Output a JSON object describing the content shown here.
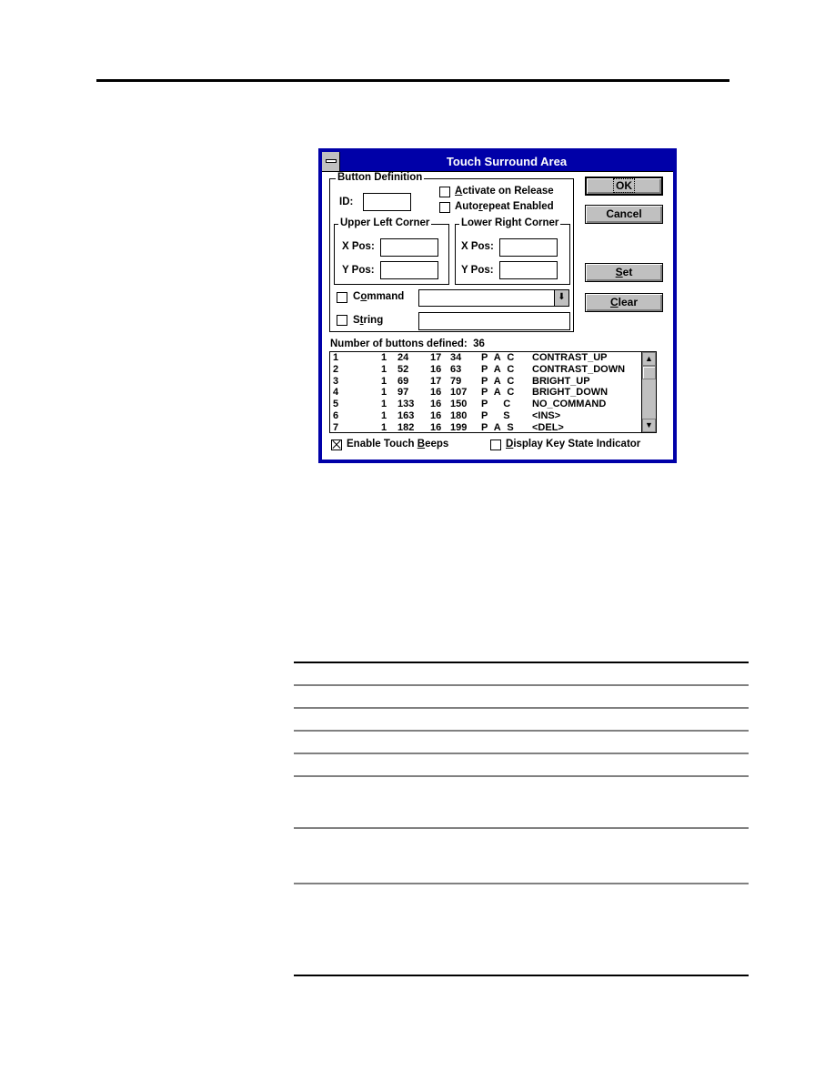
{
  "dialog": {
    "title": "Touch Surround Area",
    "button_definition": {
      "group_label": "Button Definition",
      "id_label": "ID:",
      "id_value": "",
      "activate_on_release": {
        "label_pre": "",
        "label_u": "A",
        "label_post": "ctivate on Release",
        "checked": false
      },
      "autorepeat_enabled": {
        "label_pre": "Auto",
        "label_u": "r",
        "label_post": "epeat Enabled",
        "checked": false
      },
      "upper_left": {
        "group_label": "Upper Left Corner",
        "x_label": "X Pos:",
        "y_label": "Y Pos:",
        "x_value": "",
        "y_value": ""
      },
      "lower_right": {
        "group_label": "Lower Right Corner",
        "x_label": "X Pos:",
        "y_label": "Y Pos:",
        "x_value": "",
        "y_value": ""
      },
      "command": {
        "label_pre": "C",
        "label_u": "o",
        "label_post": "mmand",
        "checked": false,
        "value": ""
      },
      "string": {
        "label_pre": "S",
        "label_u": "t",
        "label_post": "ring",
        "checked": false,
        "value": ""
      }
    },
    "buttons": {
      "ok": "OK",
      "cancel": "Cancel",
      "set_u": "S",
      "set_post": "et",
      "clear_u": "C",
      "clear_post": "lear"
    },
    "buttons_defined_label": "Number of buttons defined:",
    "buttons_defined_count": "36",
    "list_rows": [
      [
        "1",
        "1",
        "24",
        "17",
        "34",
        "P A C",
        "CONTRAST_UP"
      ],
      [
        "2",
        "1",
        "52",
        "16",
        "63",
        "P A C",
        "CONTRAST_DOWN"
      ],
      [
        "3",
        "1",
        "69",
        "17",
        "79",
        "P A C",
        "BRIGHT_UP"
      ],
      [
        "4",
        "1",
        "97",
        "16",
        "107",
        "P A C",
        "BRIGHT_DOWN"
      ],
      [
        "5",
        "1",
        "133",
        "16",
        "150",
        "P   C",
        "NO_COMMAND"
      ],
      [
        "6",
        "1",
        "163",
        "16",
        "180",
        "P   S",
        "<INS>"
      ],
      [
        "7",
        "1",
        "182",
        "16",
        "199",
        "P A S",
        "<DEL>"
      ]
    ],
    "enable_touch_beeps": {
      "label_pre": "Enable Touch ",
      "label_u": "B",
      "label_post": "eeps",
      "checked": true
    },
    "display_key_state": {
      "label_pre": "",
      "label_u": "D",
      "label_post": "isplay Key State Indicator",
      "checked": false
    },
    "icons": {
      "scroll_up": "▲",
      "scroll_down": "▼",
      "dropdown": "⬇"
    }
  }
}
